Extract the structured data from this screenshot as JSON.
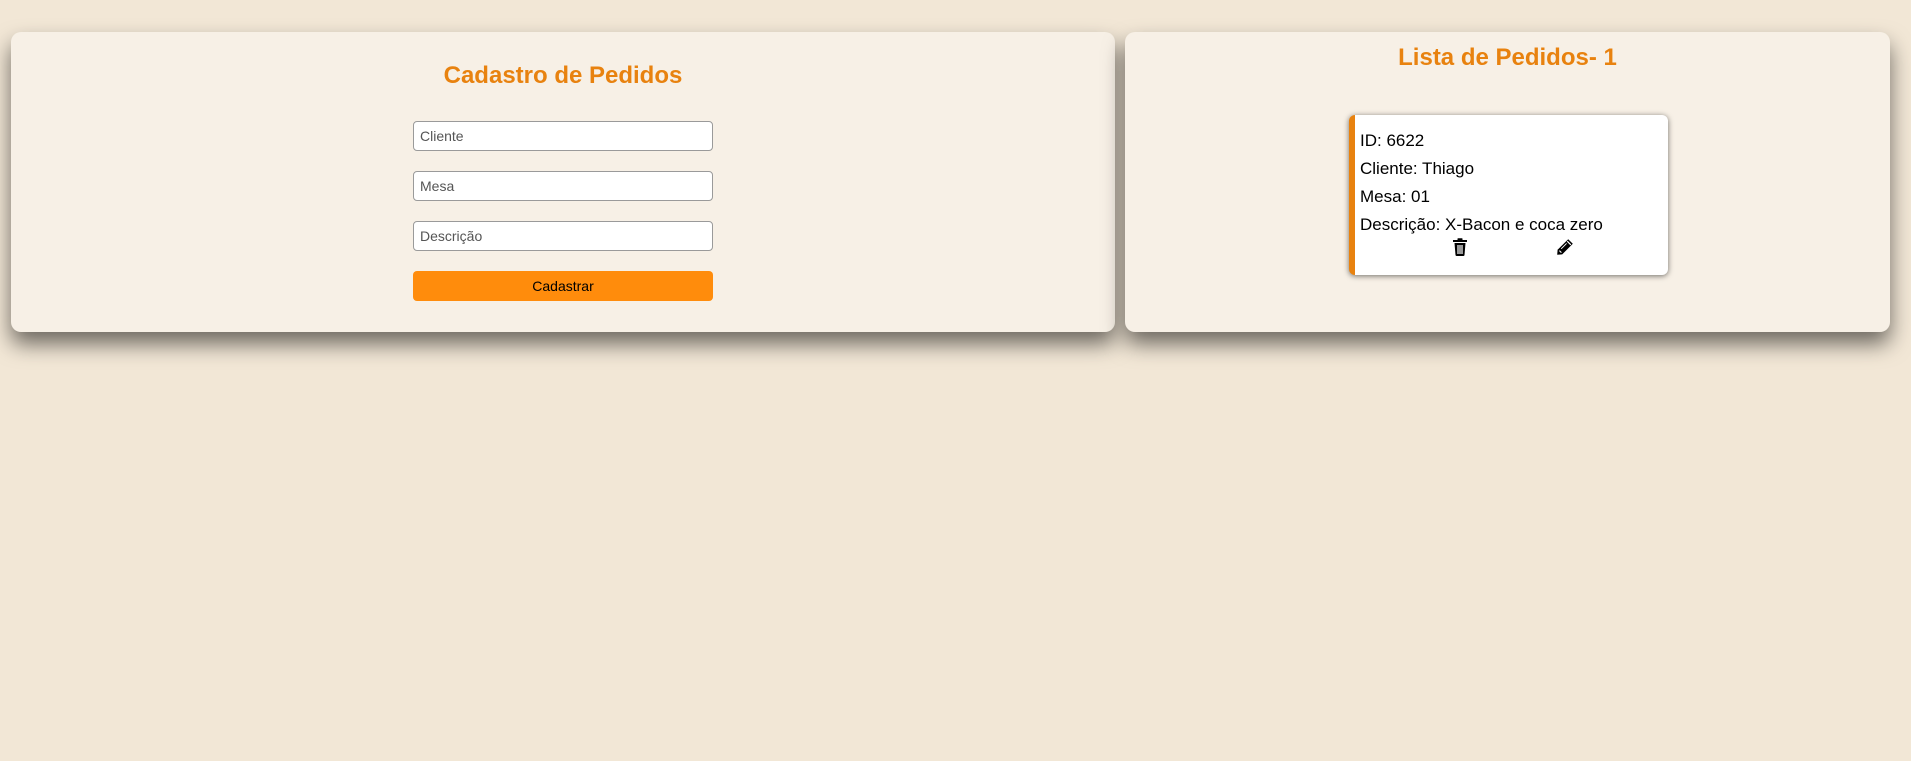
{
  "form": {
    "title": "Cadastro de Pedidos",
    "cliente_placeholder": "Cliente",
    "mesa_placeholder": "Mesa",
    "descricao_placeholder": "Descrição",
    "submit_label": "Cadastrar"
  },
  "list": {
    "title": "Lista de Pedidos- 1",
    "orders": [
      {
        "id_text": "ID: 6622",
        "cliente_text": "Cliente: Thiago",
        "mesa_text": "Mesa: 01",
        "descricao_text": "Descrição: X-Bacon e coca zero",
        "actions": [
          "trash-icon",
          "pencil-icon"
        ]
      }
    ]
  },
  "colors": {
    "background": "#f2e7d6",
    "panel": "#f7f0e6",
    "accent": "#e8820f",
    "button": "#ff8c0c"
  }
}
